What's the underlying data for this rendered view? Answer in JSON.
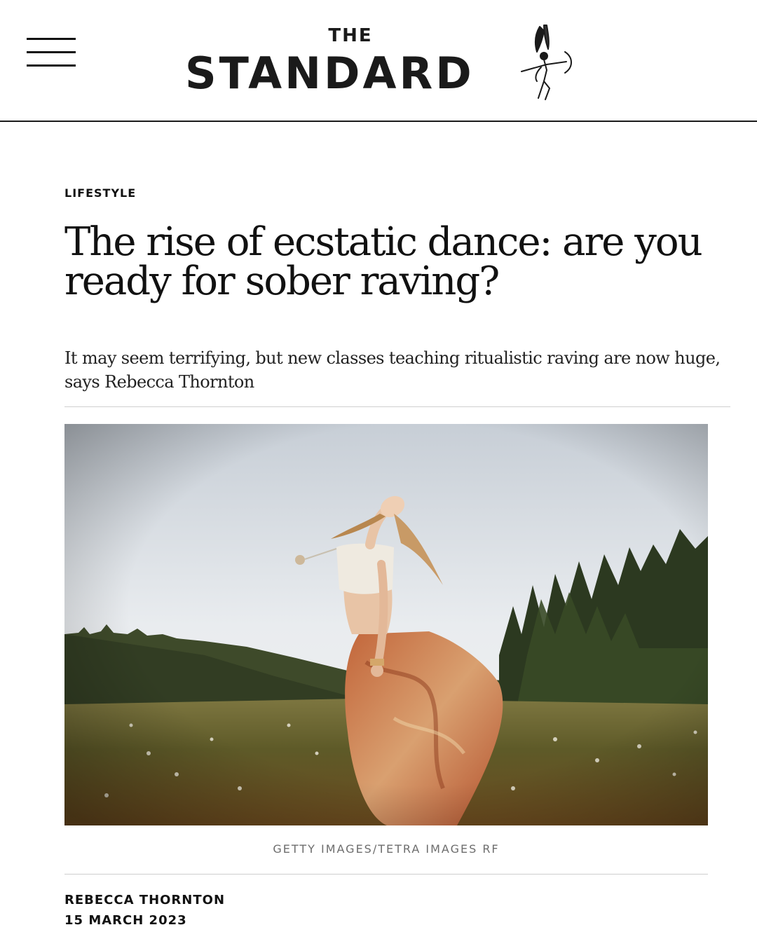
{
  "header": {
    "logo_the": "THE",
    "logo_main": "STANDARD",
    "menu_icon": "hamburger-menu-icon",
    "logo_figure_icon": "winged-figure-icon"
  },
  "article": {
    "category": "LIFESTYLE",
    "headline": "The rise of ecstatic dance: are you ready for sober raving?",
    "standfirst": "It may seem terrifying, but new classes teaching ritualistic raving are now huge, says Rebecca Thornton",
    "image_credit": "GETTY IMAGES/TETRA IMAGES RF",
    "author": "REBECCA THORNTON",
    "date": "15 MARCH 2023"
  },
  "colors": {
    "text": "#111111",
    "rule": "#cfcfcf",
    "caption": "#6d6d6d",
    "header_rule": "#1a1a1a"
  }
}
